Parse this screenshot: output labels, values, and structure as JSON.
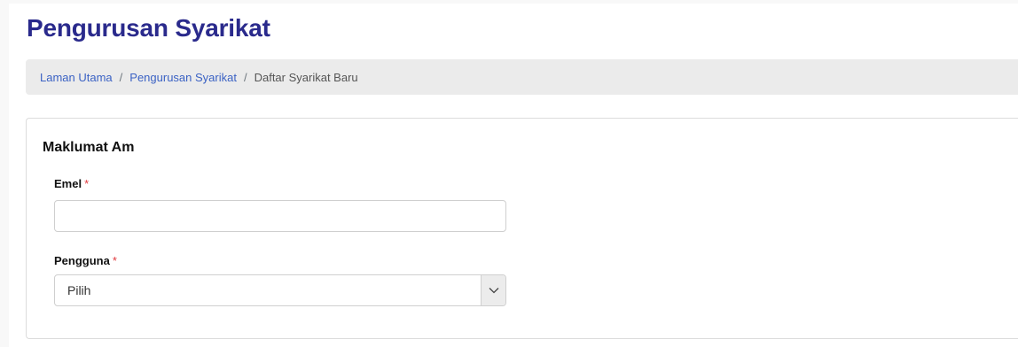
{
  "page": {
    "title": "Pengurusan Syarikat"
  },
  "breadcrumb": {
    "items": [
      {
        "label": "Laman Utama",
        "link": true
      },
      {
        "label": "Pengurusan Syarikat",
        "link": true
      },
      {
        "label": "Daftar Syarikat Baru",
        "link": false
      }
    ],
    "separator": "/"
  },
  "form": {
    "section_title": "Maklumat Am",
    "email": {
      "label": "Emel",
      "required_mark": "*",
      "value": "",
      "placeholder": ""
    },
    "user": {
      "label": "Pengguna",
      "required_mark": "*",
      "selected": "Pilih",
      "icon": "chevron-down-icon"
    }
  },
  "colors": {
    "title": "#2a2a8c",
    "link": "#3b62c4",
    "required": "#e0393e",
    "breadcrumb_bg": "#ebebeb"
  }
}
